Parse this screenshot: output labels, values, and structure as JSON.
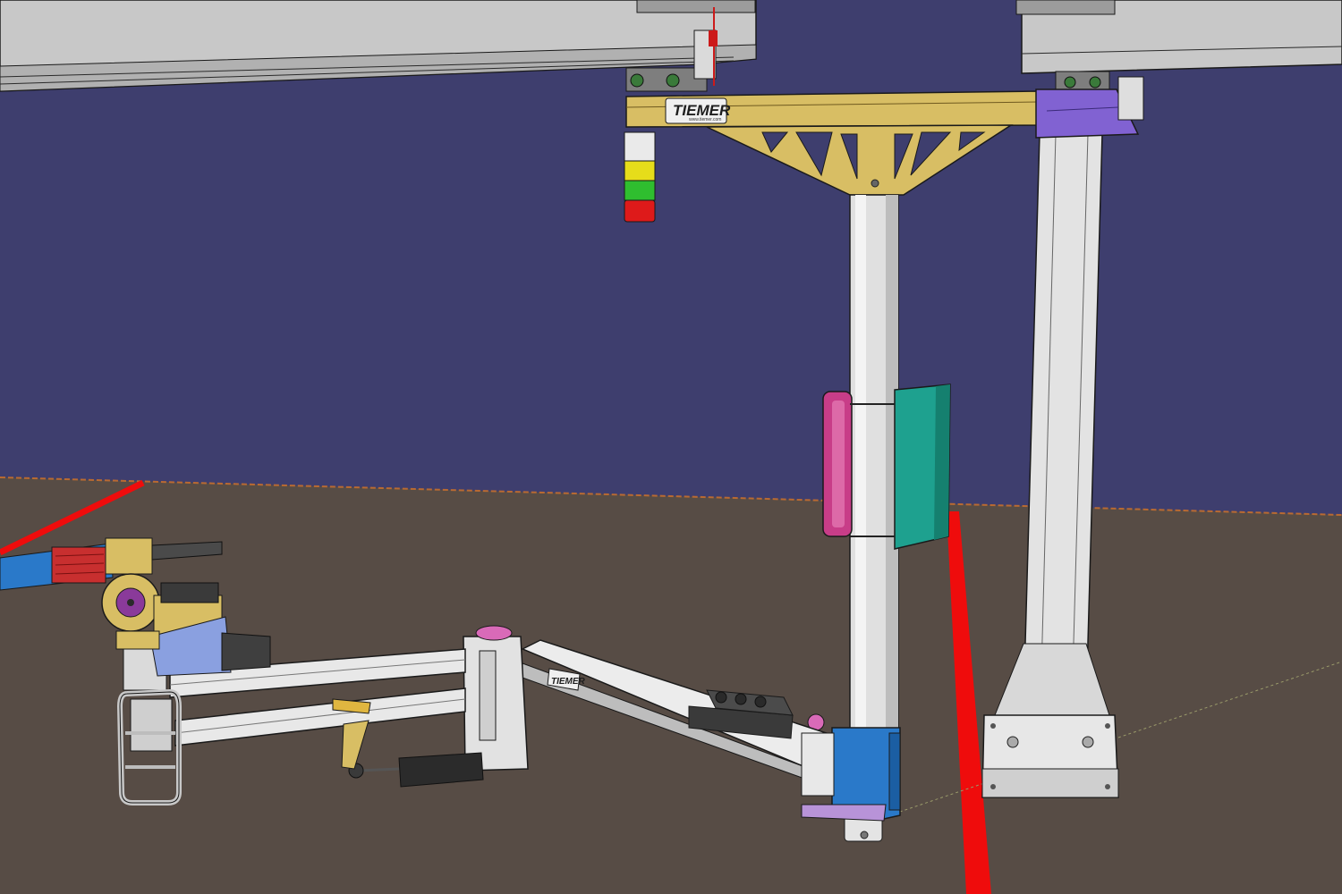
{
  "scene": {
    "brand_plate_text": "TIEMER",
    "brand_plate_subtext": "www.tiemer.com",
    "arm_plate_text": "TIEMER"
  },
  "colors": {
    "background": "#3e3e6e",
    "floor": "#574c45",
    "floor_edge": "#b96a32",
    "red_line": "#ef0c0c",
    "rail_gray": "#c8c8c8",
    "truss_gold": "#d8be64",
    "column_white": "#e0e0e0",
    "purple_bracket": "#8162d2",
    "base_blue": "#2a79c9",
    "panel_green": "#1ea18f",
    "panel_pink": "#c83d88",
    "accent_magenta": "#d96ab8",
    "signal_yellow": "#e6dd1a",
    "signal_green": "#2fbe2f",
    "signal_red": "#de1a1a"
  }
}
